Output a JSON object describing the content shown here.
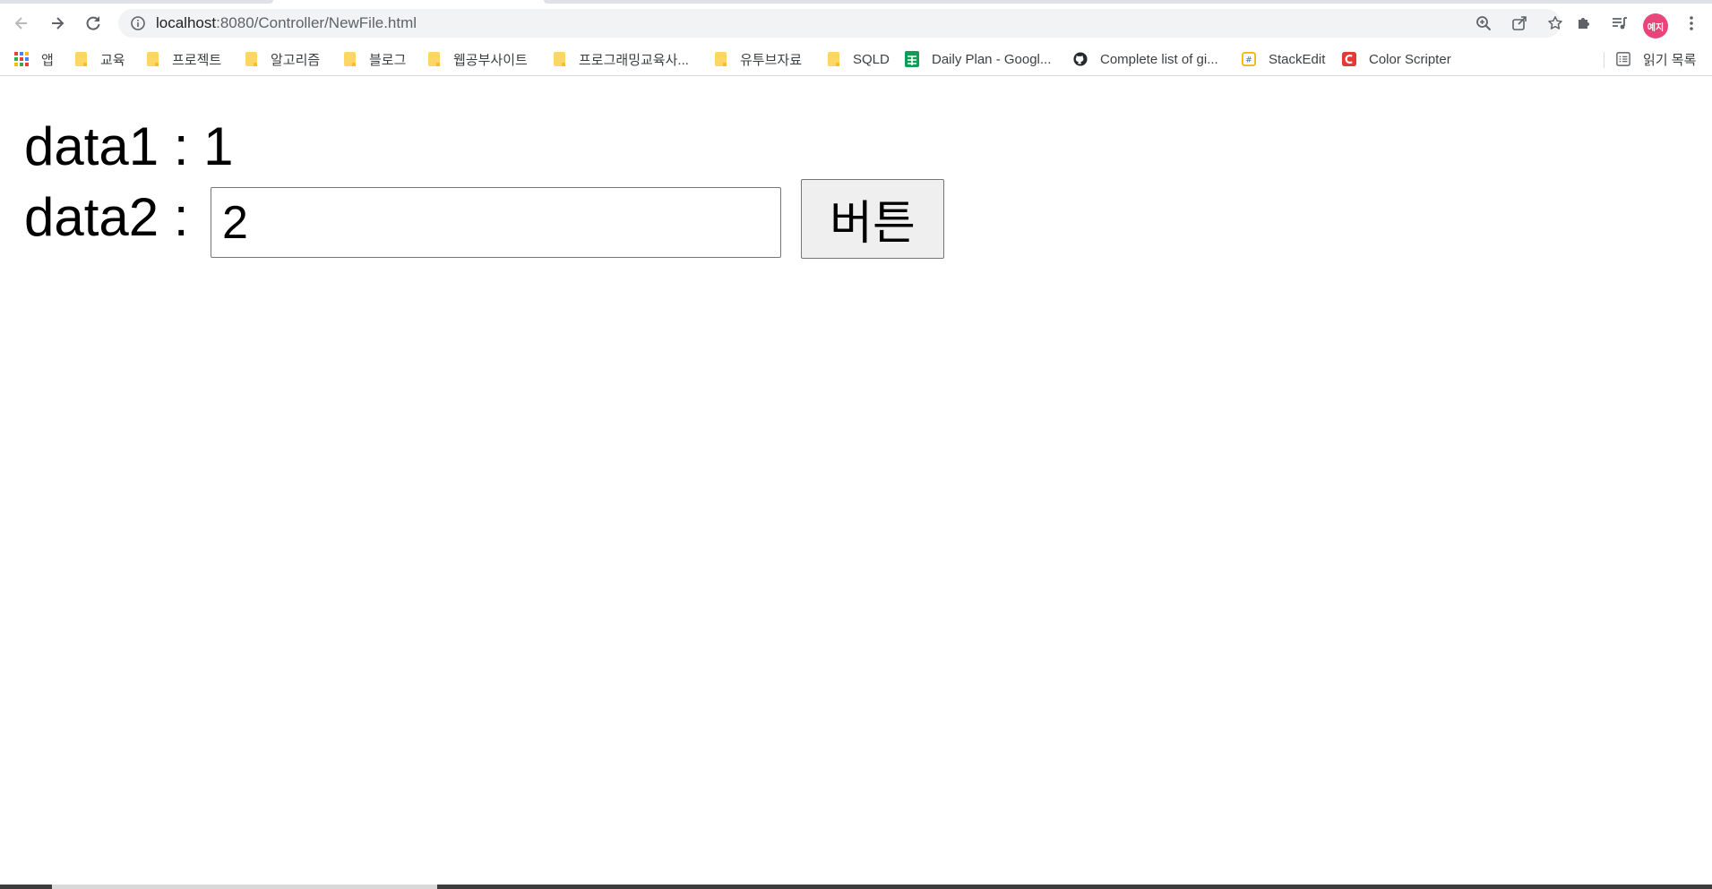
{
  "browser": {
    "url_host": "localhost",
    "url_path": ":8080/Controller/NewFile.html",
    "avatar_text": "예지",
    "avatar_color": "#e8457a"
  },
  "bookmarks": {
    "items": [
      {
        "label": "앱",
        "icon": "apps-grid-icon"
      },
      {
        "label": "교육",
        "icon": "folder-icon"
      },
      {
        "label": "프로젝트",
        "icon": "folder-icon"
      },
      {
        "label": "알고리즘",
        "icon": "folder-icon"
      },
      {
        "label": "블로그",
        "icon": "folder-icon"
      },
      {
        "label": "웹공부사이트",
        "icon": "folder-icon"
      },
      {
        "label": "프로그래밍교육사...",
        "icon": "folder-icon"
      },
      {
        "label": "유투브자료",
        "icon": "folder-icon"
      },
      {
        "label": "SQLD",
        "icon": "folder-icon"
      },
      {
        "label": "Daily Plan - Googl...",
        "icon": "google-sheets-icon"
      },
      {
        "label": "Complete list of gi...",
        "icon": "github-icon"
      },
      {
        "label": "StackEdit",
        "icon": "stackedit-icon"
      },
      {
        "label": "Color Scripter",
        "icon": "color-scripter-icon"
      }
    ],
    "reading_list": "읽기 목록"
  },
  "page": {
    "data1_label": "data1 : ",
    "data1_value": "1",
    "data2_label": "data2 : ",
    "data2_value": "2",
    "button_label": "버튼"
  }
}
